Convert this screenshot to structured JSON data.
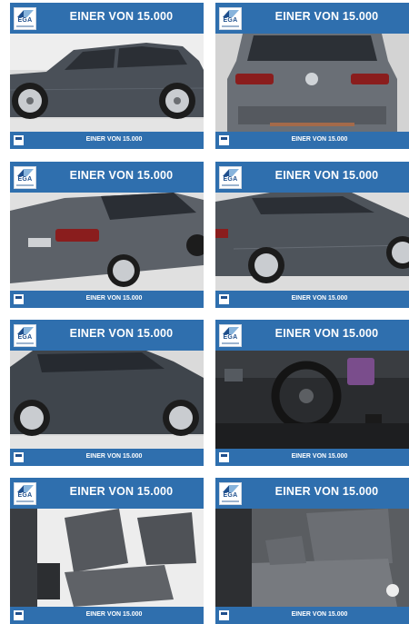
{
  "gallery": {
    "cards": [
      {
        "banner": "EINER VON 15.000",
        "logo": "EGA",
        "caption": "EINER VON 15.000",
        "photo": "car-side-left-photo"
      },
      {
        "banner": "EINER VON 15.000",
        "logo": "EGA",
        "caption": "EINER VON 15.000",
        "photo": "car-rear-photo"
      },
      {
        "banner": "EINER VON 15.000",
        "logo": "EGA",
        "caption": "EINER VON 15.000",
        "photo": "car-rear-three-quarter-photo"
      },
      {
        "banner": "EINER VON 15.000",
        "logo": "EGA",
        "caption": "EINER VON 15.000",
        "photo": "car-side-right-photo"
      },
      {
        "banner": "EINER VON 15.000",
        "logo": "EGA",
        "caption": "EINER VON 15.000",
        "photo": "car-side-left-2-photo"
      },
      {
        "banner": "EINER VON 15.000",
        "logo": "EGA",
        "caption": "EINER VON 15.000",
        "photo": "dashboard-interior-photo"
      },
      {
        "banner": "EINER VON 15.000",
        "logo": "EGA",
        "caption": "EINER VON 15.000",
        "photo": "front-seats-photo"
      },
      {
        "banner": "EINER VON 15.000",
        "logo": "EGA",
        "caption": "EINER VON 15.000",
        "photo": "rear-seats-photo"
      }
    ]
  },
  "colors": {
    "banner": "#2f6fae",
    "car_body": "#4a5058",
    "background": "#d9d9d9"
  }
}
